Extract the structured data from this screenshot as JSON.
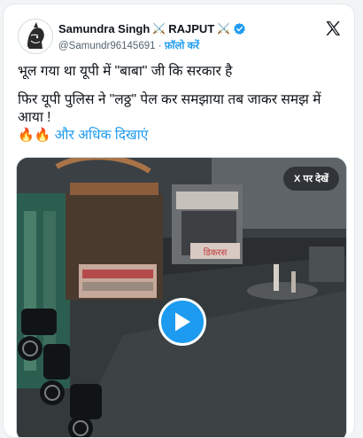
{
  "author": {
    "display_name": "Samundra Singh",
    "swords_left": "⚔️",
    "tag": "RAJPUT",
    "swords_right": "⚔️",
    "handle": "@Samundr96145691",
    "separator": "·",
    "follow_label": "फ़ॉलो करें",
    "verified_color": "#1d9bf0",
    "avatar_icon": "warrior-avatar-icon"
  },
  "platform": {
    "logo_icon": "x-logo-icon"
  },
  "tweet": {
    "line1": "भूल गया था यूपी में \"बाबा\" जी कि सरकार है",
    "line2": "फिर यूपी पुलिस ने \"लठ्ठ\" पेल कर समझाया तब जाकर समझ में आया  !",
    "emojis": "🔥🔥",
    "show_more": "और अधिक दिखाएं",
    "link_color": "#1d9bf0"
  },
  "media": {
    "view_on_x_label": "X पर देखें",
    "play_icon": "play-icon",
    "sign_text": "डिकरस"
  }
}
